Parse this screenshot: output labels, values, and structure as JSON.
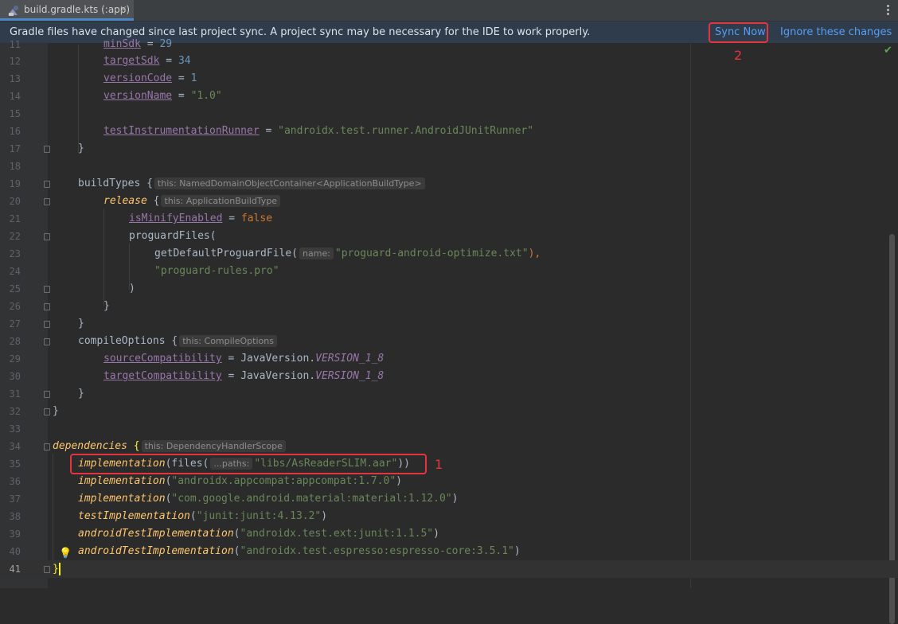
{
  "tab": {
    "label": "build.gradle.kts (:app)",
    "close": "×",
    "icon": "gradle-file-icon"
  },
  "banner": {
    "message": "Gradle files have changed since last project sync. A project sync may be necessary for the IDE to work properly.",
    "sync_label": "Sync Now",
    "ignore_label": "Ignore these changes"
  },
  "annotations": {
    "one": "1",
    "two": "2"
  },
  "colors": {
    "accent": "#4a88c7",
    "annotation": "#e5343d",
    "link": "#589df6"
  },
  "lines": {
    "l11": {
      "num": "11",
      "prop": "minSdk",
      "op": " = ",
      "val": "29"
    },
    "l12": {
      "num": "12",
      "prop": "targetSdk",
      "op": " = ",
      "val": "34"
    },
    "l13": {
      "num": "13",
      "prop": "versionCode",
      "op": " = ",
      "val": "1"
    },
    "l14": {
      "num": "14",
      "prop": "versionName",
      "op": " = ",
      "val": "\"1.0\""
    },
    "l15": {
      "num": "15"
    },
    "l16": {
      "num": "16",
      "prop": "testInstrumentationRunner",
      "op": " = ",
      "val": "\"androidx.test.runner.AndroidJUnitRunner\""
    },
    "l17": {
      "num": "17",
      "text": "}"
    },
    "l18": {
      "num": "18"
    },
    "l19": {
      "num": "19",
      "text": "buildTypes {",
      "hint": "this: NamedDomainObjectContainer<ApplicationBuildType>"
    },
    "l20": {
      "num": "20",
      "fn": "release",
      "text": " {",
      "hint": "this: ApplicationBuildType"
    },
    "l21": {
      "num": "21",
      "prop": "isMinifyEnabled",
      "op": " = ",
      "val": "false"
    },
    "l22": {
      "num": "22",
      "text": "proguardFiles("
    },
    "l23": {
      "num": "23",
      "text": "getDefaultProguardFile(",
      "hint": "name:",
      "val": "\"proguard-android-optimize.txt\"",
      "tail": "),"
    },
    "l24": {
      "num": "24",
      "val": "\"proguard-rules.pro\""
    },
    "l25": {
      "num": "25",
      "text": ")"
    },
    "l26": {
      "num": "26",
      "text": "}"
    },
    "l27": {
      "num": "27",
      "text": "}"
    },
    "l28": {
      "num": "28",
      "text": "compileOptions {",
      "hint": "this: CompileOptions"
    },
    "l29": {
      "num": "29",
      "prop": "sourceCompatibility",
      "op": " = JavaVersion.",
      "val": "VERSION_1_8"
    },
    "l30": {
      "num": "30",
      "prop": "targetCompatibility",
      "op": " = JavaVersion.",
      "val": "VERSION_1_8"
    },
    "l31": {
      "num": "31",
      "text": "}"
    },
    "l32": {
      "num": "32",
      "text": "}"
    },
    "l33": {
      "num": "33"
    },
    "l34": {
      "num": "34",
      "fn": "dependencies",
      "text": "{",
      "hint": "this: DependencyHandlerScope"
    },
    "l35": {
      "num": "35",
      "fn": "implementation",
      "text": "(files(",
      "hint": "...paths:",
      "val": "\"libs/AsReaderSLIM.aar\"",
      "tail": "))"
    },
    "l36": {
      "num": "36",
      "fn": "implementation",
      "val": "\"androidx.appcompat:appcompat:1.7.0\""
    },
    "l37": {
      "num": "37",
      "fn": "implementation",
      "val": "\"com.google.android.material:material:1.12.0\""
    },
    "l38": {
      "num": "38",
      "fn": "testImplementation",
      "val": "\"junit:junit:4.13.2\""
    },
    "l39": {
      "num": "39",
      "fn": "androidTestImplementation",
      "val": "\"androidx.test.ext:junit:1.1.5\""
    },
    "l40": {
      "num": "40",
      "fn": "androidTestImplementation",
      "val": "\"androidx.test.espresso:espresso-core:3.5.1\""
    },
    "l41": {
      "num": "41",
      "text": "}"
    }
  }
}
